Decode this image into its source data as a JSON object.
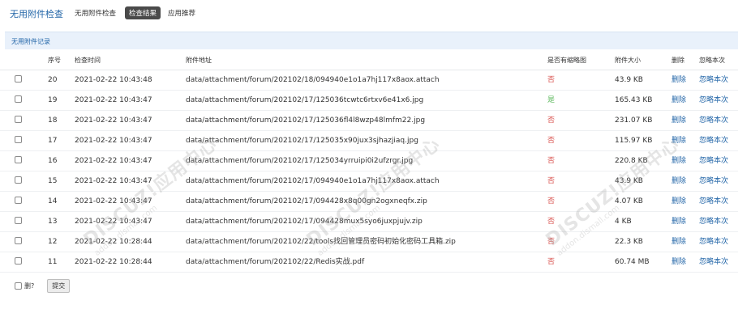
{
  "app": {
    "title": "无用附件检查"
  },
  "nav": {
    "items": [
      {
        "label": "无用附件检查"
      },
      {
        "label": "检查结果",
        "active": true
      },
      {
        "label": "应用推荐"
      }
    ]
  },
  "section": {
    "title": "无用附件记录"
  },
  "table": {
    "headers": {
      "seq": "序号",
      "time": "检查时间",
      "path": "附件地址",
      "thumb": "是否有缩略图",
      "size": "附件大小",
      "delete": "删除",
      "ignore": "忽略本次"
    },
    "rows": [
      {
        "seq": "20",
        "time": "2021-02-22 10:43:48",
        "path": "data/attachment/forum/202102/18/094940e1o1a7hj117x8aox.attach",
        "thumb": "否",
        "size": "43.9 KB",
        "delete": "删除",
        "ignore": "忽略本次"
      },
      {
        "seq": "19",
        "time": "2021-02-22 10:43:47",
        "path": "data/attachment/forum/202102/17/125036tcwtc6rtxv6e41x6.jpg",
        "thumb": "是",
        "size": "165.43 KB",
        "delete": "删除",
        "ignore": "忽略本次"
      },
      {
        "seq": "18",
        "time": "2021-02-22 10:43:47",
        "path": "data/attachment/forum/202102/17/125036fl4l8wzp48lmfm22.jpg",
        "thumb": "否",
        "size": "231.07 KB",
        "delete": "删除",
        "ignore": "忽略本次"
      },
      {
        "seq": "17",
        "time": "2021-02-22 10:43:47",
        "path": "data/attachment/forum/202102/17/125035x90jux3sjhazjiaq.jpg",
        "thumb": "否",
        "size": "115.97 KB",
        "delete": "删除",
        "ignore": "忽略本次"
      },
      {
        "seq": "16",
        "time": "2021-02-22 10:43:47",
        "path": "data/attachment/forum/202102/17/125034yrruipi0i2ufzrgr.jpg",
        "thumb": "否",
        "size": "220.8 KB",
        "delete": "删除",
        "ignore": "忽略本次"
      },
      {
        "seq": "15",
        "time": "2021-02-22 10:43:47",
        "path": "data/attachment/forum/202102/17/094940e1o1a7hj117x8aox.attach",
        "thumb": "否",
        "size": "43.9 KB",
        "delete": "删除",
        "ignore": "忽略本次"
      },
      {
        "seq": "14",
        "time": "2021-02-22 10:43:47",
        "path": "data/attachment/forum/202102/17/094428x8q00gn2ogxneqfx.zip",
        "thumb": "否",
        "size": "4.07 KB",
        "delete": "删除",
        "ignore": "忽略本次"
      },
      {
        "seq": "13",
        "time": "2021-02-22 10:43:47",
        "path": "data/attachment/forum/202102/17/094428mux5syo6juxpjujv.zip",
        "thumb": "否",
        "size": "4 KB",
        "delete": "删除",
        "ignore": "忽略本次"
      },
      {
        "seq": "12",
        "time": "2021-02-22 10:28:44",
        "path": "data/attachment/forum/202102/22/tools找回管理员密码初始化密码工具箱.zip",
        "thumb": "否",
        "size": "22.3 KB",
        "delete": "删除",
        "ignore": "忽略本次"
      },
      {
        "seq": "11",
        "time": "2021-02-22 10:28:44",
        "path": "data/attachment/forum/202102/22/Redis实战.pdf",
        "thumb": "否",
        "size": "60.74 MB",
        "delete": "删除",
        "ignore": "忽略本次"
      }
    ]
  },
  "footer": {
    "checkbox_label": "删?",
    "submit_label": "提交"
  },
  "watermark": {
    "brand": "DISCUZ!应用中心",
    "domain": "addon.dismall.com",
    "name": "贰道"
  },
  "colors": {
    "link": "#2366a8",
    "no": "#d9534f",
    "yes": "#5cb85c",
    "section_bg": "#e9f1fb"
  }
}
